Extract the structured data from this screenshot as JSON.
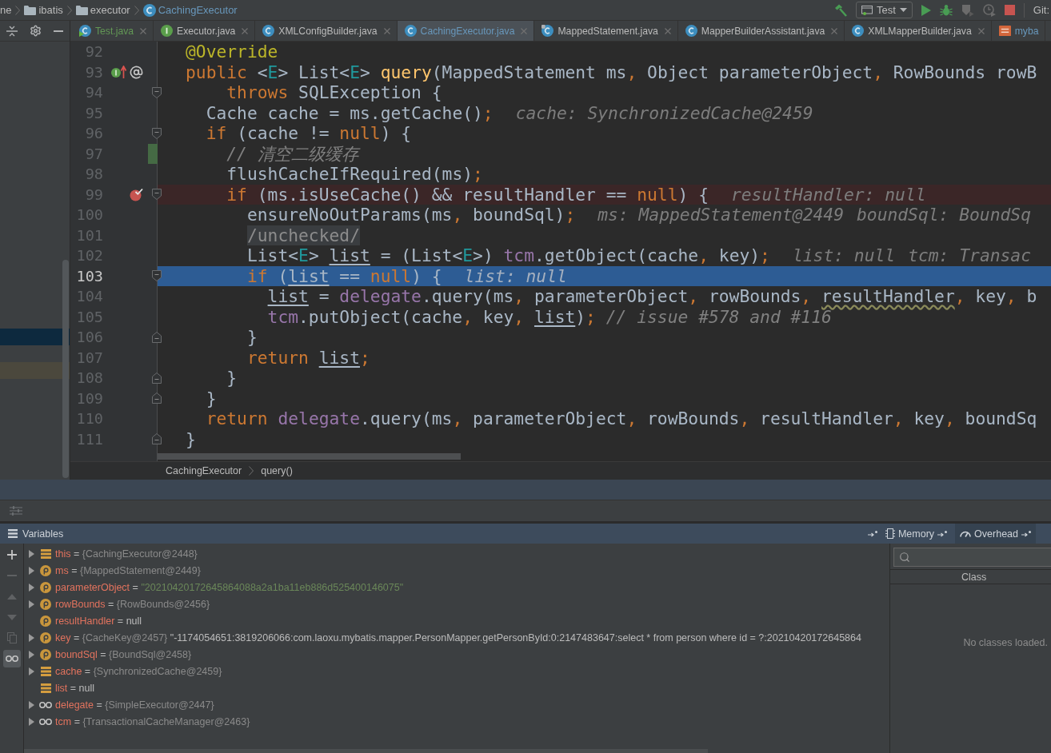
{
  "top_bar": {
    "breadcrumbs": [
      {
        "kind": "text",
        "label": "ne",
        "color": "#bbbbbb"
      },
      {
        "kind": "folder",
        "label": "ibatis",
        "color": "#bbbbbb"
      },
      {
        "kind": "folder",
        "label": "executor",
        "color": "#bbbbbb"
      },
      {
        "kind": "class",
        "label": "CachingExecutor",
        "color": "#6897bb"
      }
    ],
    "toolbar": [
      {
        "kind": "build",
        "disabled": false
      },
      {
        "kind": "config",
        "label": "Test"
      },
      {
        "kind": "run",
        "disabled": false
      },
      {
        "kind": "debug",
        "disabled": false
      },
      {
        "kind": "coverage",
        "disabled": true
      },
      {
        "kind": "profile",
        "disabled": true
      },
      {
        "kind": "stop",
        "disabled": false
      },
      {
        "kind": "vcs",
        "label": "Git:"
      }
    ]
  },
  "project_panel": {
    "rows": [
      {
        "selected": false
      },
      {
        "selected": false
      },
      {
        "selected": false
      },
      {
        "selected": false
      },
      {
        "selected": false
      },
      {
        "selected": false
      },
      {
        "selected": false
      },
      {
        "selected": false
      },
      {
        "selected": false
      },
      {
        "selected": false
      },
      {
        "selected": false
      },
      {
        "selected": false
      },
      {
        "selected": false
      },
      {
        "selected": false
      },
      {
        "selected": false
      },
      {
        "selected": false
      },
      {
        "selected": false
      },
      {
        "selected": true
      },
      {
        "selected": false
      },
      {
        "selected": false,
        "color": "#4b483d"
      }
    ]
  },
  "tabs": [
    {
      "label": "Test.java",
      "kind": "test",
      "color": "#629755",
      "selected": false,
      "closable": true
    },
    {
      "label": "Executor.java",
      "kind": "interface",
      "color": "#bbbbbb",
      "selected": false,
      "closable": true
    },
    {
      "label": "XMLConfigBuilder.java",
      "kind": "class",
      "color": "#bbbbbb",
      "selected": false,
      "closable": true
    },
    {
      "label": "CachingExecutor.java",
      "kind": "class",
      "color": "#6897bb",
      "selected": true,
      "closable": true
    },
    {
      "label": "MappedStatement.java",
      "kind": "final",
      "color": "#bbbbbb",
      "selected": false,
      "closable": true
    },
    {
      "label": "MapperBuilderAssistant.java",
      "kind": "class",
      "color": "#bbbbbb",
      "selected": false,
      "closable": true
    },
    {
      "label": "XMLMapperBuilder.java",
      "kind": "class",
      "color": "#bbbbbb",
      "selected": false,
      "closable": true
    },
    {
      "label": "myba",
      "kind": "module",
      "color": "#6897bb",
      "selected": false,
      "closable": false
    }
  ],
  "editor": {
    "lines": [
      {
        "number": "92",
        "breakpoint": false,
        "current": false,
        "changed": false,
        "fold_start": false,
        "fold_end": false,
        "tokens": [
          {
            "kind": "annotation",
            "text": "@Override"
          }
        ]
      },
      {
        "number": "93",
        "breakpoint": false,
        "current": false,
        "changed": false,
        "fold_start": false,
        "fold_end": false,
        "gutter": [
          {
            "kind": "implements"
          },
          {
            "kind": "annotation"
          }
        ],
        "tokens": [
          {
            "kind": "keyword",
            "text": "public"
          },
          {
            "kind": "plain",
            "text": " <"
          },
          {
            "kind": "type_param",
            "text": "E"
          },
          {
            "kind": "plain",
            "text": "> List<"
          },
          {
            "kind": "type_param",
            "text": "E"
          },
          {
            "kind": "plain",
            "text": "> "
          },
          {
            "kind": "method",
            "text": "query"
          },
          {
            "kind": "plain",
            "text": "(MappedStatement ms"
          },
          {
            "kind": "punct",
            "text": ","
          },
          {
            "kind": "plain",
            "text": " Object parameterObject"
          },
          {
            "kind": "punct",
            "text": ","
          },
          {
            "kind": "plain",
            "text": " RowBounds rowB"
          }
        ]
      },
      {
        "number": "94",
        "breakpoint": false,
        "current": false,
        "changed": false,
        "fold_start": true,
        "fold_end": false,
        "tokens": [
          {
            "kind": "keyword",
            "text": "    throws"
          },
          {
            "kind": "plain",
            "text": " SQLException {"
          }
        ]
      },
      {
        "number": "95",
        "breakpoint": false,
        "current": false,
        "changed": false,
        "fold_start": false,
        "fold_end": false,
        "tokens": [
          {
            "kind": "plain",
            "text": "  Cache cache = ms.getCache()"
          },
          {
            "kind": "punct",
            "text": ";"
          }
        ],
        "hints": [
          "cache: SynchronizedCache@2459"
        ]
      },
      {
        "number": "96",
        "breakpoint": false,
        "current": false,
        "changed": false,
        "fold_start": true,
        "fold_end": false,
        "tokens": [
          {
            "kind": "keyword",
            "text": "  if"
          },
          {
            "kind": "plain",
            "text": " (cache != "
          },
          {
            "kind": "keyword",
            "text": "null"
          },
          {
            "kind": "plain",
            "text": ") {"
          }
        ]
      },
      {
        "number": "97",
        "breakpoint": false,
        "current": false,
        "changed": true,
        "fold_start": false,
        "fold_end": false,
        "tokens": [
          {
            "kind": "comment",
            "text": "    // 清空二级缓存"
          }
        ]
      },
      {
        "number": "98",
        "breakpoint": false,
        "current": false,
        "changed": false,
        "fold_start": false,
        "fold_end": false,
        "tokens": [
          {
            "kind": "plain",
            "text": "    flushCacheIfRequired(ms)"
          },
          {
            "kind": "punct",
            "text": ";"
          }
        ]
      },
      {
        "number": "99",
        "breakpoint": true,
        "current": false,
        "changed": false,
        "fold_start": true,
        "fold_end": false,
        "tokens": [
          {
            "kind": "keyword",
            "text": "    if"
          },
          {
            "kind": "plain",
            "text": " (ms.isUseCache() && resultHandler == "
          },
          {
            "kind": "keyword",
            "text": "null"
          },
          {
            "kind": "plain",
            "text": ") {"
          }
        ],
        "hints": [
          "resultHandler: null"
        ]
      },
      {
        "number": "100",
        "breakpoint": false,
        "current": false,
        "changed": false,
        "fold_start": false,
        "fold_end": false,
        "tokens": [
          {
            "kind": "plain",
            "text": "      ensureNoOutParams(ms"
          },
          {
            "kind": "punct",
            "text": ","
          },
          {
            "kind": "plain",
            "text": " boundSql)"
          },
          {
            "kind": "punct",
            "text": ";"
          }
        ],
        "hints": [
          "ms: MappedStatement@2449",
          "boundSql: BoundSq"
        ]
      },
      {
        "number": "101",
        "breakpoint": false,
        "current": false,
        "changed": false,
        "fold_start": false,
        "fold_end": false,
        "tokens": [
          {
            "kind": "folded",
            "text": "      /unchecked/"
          }
        ]
      },
      {
        "number": "102",
        "breakpoint": false,
        "current": false,
        "changed": false,
        "fold_start": false,
        "fold_end": false,
        "tokens": [
          {
            "kind": "plain",
            "text": "      List<"
          },
          {
            "kind": "type_param",
            "text": "E"
          },
          {
            "kind": "plain",
            "text": "> "
          },
          {
            "kind": "reassigned",
            "text": "list"
          },
          {
            "kind": "plain",
            "text": " = (List<"
          },
          {
            "kind": "type_param",
            "text": "E"
          },
          {
            "kind": "plain",
            "text": ">) "
          },
          {
            "kind": "field",
            "text": "tcm"
          },
          {
            "kind": "plain",
            "text": ".getObject(cache"
          },
          {
            "kind": "punct",
            "text": ","
          },
          {
            "kind": "plain",
            "text": " key)"
          },
          {
            "kind": "punct",
            "text": ";"
          }
        ],
        "hints": [
          "list: null",
          "tcm: Transac"
        ]
      },
      {
        "number": "103",
        "breakpoint": false,
        "current": true,
        "changed": false,
        "fold_start": true,
        "fold_end": false,
        "tokens": [
          {
            "kind": "keyword",
            "text": "      if"
          },
          {
            "kind": "plain",
            "text": " ("
          },
          {
            "kind": "reassigned",
            "text": "list"
          },
          {
            "kind": "plain",
            "text": " == "
          },
          {
            "kind": "keyword",
            "text": "null"
          },
          {
            "kind": "plain",
            "text": ") {"
          }
        ],
        "hints": [
          "list: null"
        ]
      },
      {
        "number": "104",
        "breakpoint": false,
        "current": false,
        "changed": false,
        "fold_start": false,
        "fold_end": false,
        "tokens": [
          {
            "kind": "reassigned",
            "text": "        list"
          },
          {
            "kind": "plain",
            "text": " = "
          },
          {
            "kind": "field",
            "text": "delegate"
          },
          {
            "kind": "plain",
            "text": ".query(ms"
          },
          {
            "kind": "punct",
            "text": ","
          },
          {
            "kind": "plain",
            "text": " parameterObject"
          },
          {
            "kind": "punct",
            "text": ","
          },
          {
            "kind": "plain",
            "text": " rowBounds"
          },
          {
            "kind": "punct",
            "text": ", "
          },
          {
            "kind": "warning",
            "text": "resultHandler"
          },
          {
            "kind": "punct",
            "text": ","
          },
          {
            "kind": "plain",
            "text": " key"
          },
          {
            "kind": "punct",
            "text": ","
          },
          {
            "kind": "plain",
            "text": " b"
          }
        ]
      },
      {
        "number": "105",
        "breakpoint": false,
        "current": false,
        "changed": false,
        "fold_start": false,
        "fold_end": false,
        "tokens": [
          {
            "kind": "field",
            "text": "        tcm"
          },
          {
            "kind": "plain",
            "text": ".putObject(cache"
          },
          {
            "kind": "punct",
            "text": ","
          },
          {
            "kind": "plain",
            "text": " key"
          },
          {
            "kind": "punct",
            "text": ", "
          },
          {
            "kind": "reassigned",
            "text": "list"
          },
          {
            "kind": "plain",
            "text": ")"
          },
          {
            "kind": "punct",
            "text": ";"
          },
          {
            "kind": "comment",
            "text": " // issue #578 and #116"
          }
        ]
      },
      {
        "number": "106",
        "breakpoint": false,
        "current": false,
        "changed": false,
        "fold_start": false,
        "fold_end": true,
        "tokens": [
          {
            "kind": "plain",
            "text": "      }"
          }
        ]
      },
      {
        "number": "107",
        "breakpoint": false,
        "current": false,
        "changed": false,
        "fold_start": false,
        "fold_end": false,
        "tokens": [
          {
            "kind": "keyword",
            "text": "      return "
          },
          {
            "kind": "reassigned",
            "text": "list"
          },
          {
            "kind": "punct",
            "text": ";"
          }
        ]
      },
      {
        "number": "108",
        "breakpoint": false,
        "current": false,
        "changed": false,
        "fold_start": false,
        "fold_end": true,
        "tokens": [
          {
            "kind": "plain",
            "text": "    }"
          }
        ]
      },
      {
        "number": "109",
        "breakpoint": false,
        "current": false,
        "changed": false,
        "fold_start": false,
        "fold_end": true,
        "tokens": [
          {
            "kind": "plain",
            "text": "  }"
          }
        ]
      },
      {
        "number": "110",
        "breakpoint": false,
        "current": false,
        "changed": false,
        "fold_start": false,
        "fold_end": false,
        "tokens": [
          {
            "kind": "keyword",
            "text": "  return "
          },
          {
            "kind": "field",
            "text": "delegate"
          },
          {
            "kind": "plain",
            "text": ".query(ms"
          },
          {
            "kind": "punct",
            "text": ","
          },
          {
            "kind": "plain",
            "text": " parameterObject"
          },
          {
            "kind": "punct",
            "text": ","
          },
          {
            "kind": "plain",
            "text": " rowBounds"
          },
          {
            "kind": "punct",
            "text": ","
          },
          {
            "kind": "plain",
            "text": " resultHandler"
          },
          {
            "kind": "punct",
            "text": ","
          },
          {
            "kind": "plain",
            "text": " key"
          },
          {
            "kind": "punct",
            "text": ","
          },
          {
            "kind": "plain",
            "text": " boundSq"
          }
        ]
      },
      {
        "number": "111",
        "breakpoint": false,
        "current": false,
        "changed": false,
        "fold_start": false,
        "fold_end": true,
        "tokens": [
          {
            "kind": "plain",
            "text": "}"
          }
        ]
      }
    ],
    "breadcrumbs": [
      "CachingExecutor",
      "query()"
    ]
  },
  "debug": {
    "panel": {
      "title": "Variables"
    },
    "panel_tabs": [
      {
        "kind": "memory",
        "label": "Memory",
        "selected": false
      },
      {
        "kind": "overhead",
        "label": "Overhead",
        "selected": true
      }
    ],
    "side_toolbar": [
      {
        "kind": "add",
        "disabled": false,
        "selected": false
      },
      {
        "kind": "remove",
        "disabled": true,
        "selected": false
      },
      {
        "kind": "up",
        "disabled": true,
        "selected": false
      },
      {
        "kind": "down",
        "disabled": true,
        "selected": false
      },
      {
        "kind": "copy",
        "disabled": true,
        "selected": false
      },
      {
        "kind": "watches",
        "disabled": false,
        "selected": true
      }
    ],
    "variables": [
      {
        "kind": "local",
        "expandable": true,
        "name": "this",
        "operator": "=",
        "value": [
          {
            "kind": "object",
            "text": "{CachingExecutor@2448}"
          }
        ]
      },
      {
        "kind": "parameter",
        "expandable": true,
        "name": "ms",
        "operator": "=",
        "value": [
          {
            "kind": "object",
            "text": "{MappedStatement@2449}"
          }
        ]
      },
      {
        "kind": "parameter",
        "expandable": true,
        "name": "parameterObject",
        "operator": "=",
        "value": [
          {
            "kind": "string",
            "text": "\"20210420172645864088a2a1ba11eb886d525400146075\""
          }
        ]
      },
      {
        "kind": "parameter",
        "expandable": true,
        "name": "rowBounds",
        "operator": "=",
        "value": [
          {
            "kind": "object",
            "text": "{RowBounds@2456}"
          }
        ]
      },
      {
        "kind": "parameter",
        "expandable": false,
        "name": "resultHandler",
        "operator": "=",
        "value": [
          {
            "kind": "null",
            "text": "null"
          }
        ]
      },
      {
        "kind": "parameter",
        "expandable": true,
        "name": "key",
        "operator": "=",
        "value": [
          {
            "kind": "object",
            "text": "{CacheKey@2457}"
          },
          {
            "kind": "text",
            "text": "\"-1174054651:3819206066:com.laoxu.mybatis.mapper.PersonMapper.getPersonById:0:2147483647:select * from person where id = ?:20210420172645864"
          }
        ]
      },
      {
        "kind": "parameter",
        "expandable": true,
        "name": "boundSql",
        "operator": "=",
        "value": [
          {
            "kind": "object",
            "text": "{BoundSql@2458}"
          }
        ]
      },
      {
        "kind": "local",
        "expandable": true,
        "name": "cache",
        "operator": "=",
        "value": [
          {
            "kind": "object",
            "text": "{SynchronizedCache@2459}"
          }
        ]
      },
      {
        "kind": "local",
        "expandable": false,
        "name": "list",
        "operator": "=",
        "value": [
          {
            "kind": "null",
            "text": "null"
          }
        ]
      },
      {
        "kind": "field",
        "expandable": true,
        "name": "delegate",
        "operator": "=",
        "value": [
          {
            "kind": "object",
            "text": "{SimpleExecutor@2447}"
          }
        ]
      },
      {
        "kind": "field",
        "expandable": true,
        "name": "tcm",
        "operator": "=",
        "value": [
          {
            "kind": "object",
            "text": "{TransactionalCacheManager@2463}"
          }
        ]
      }
    ],
    "memory": {
      "column": "Class",
      "empty_text": "No classes loaded."
    }
  }
}
